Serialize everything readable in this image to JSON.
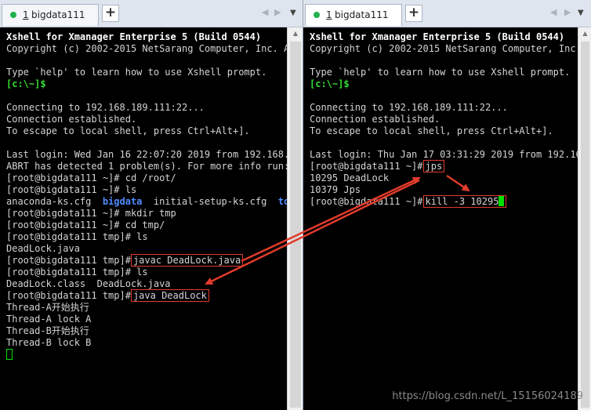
{
  "left_pane": {
    "tab": {
      "number": "1",
      "name": "bigdata111"
    },
    "add_tab": "+",
    "nav": {
      "prev": "◀",
      "next": "▶",
      "menu": "▼"
    },
    "lines": [
      [
        {
          "t": "Xshell for Xmanager Enterprise 5 (Build 0544)",
          "s": "b"
        }
      ],
      [
        {
          "t": "Copyright (c) 2002-2015 NetSarang Computer, Inc. A"
        }
      ],
      [],
      [
        {
          "t": "Type `help' to learn how to use Xshell prompt."
        }
      ],
      [
        {
          "t": "[c:\\~]$",
          "s": "green"
        }
      ],
      [],
      [
        {
          "t": "Connecting to 192.168.189.111:22..."
        }
      ],
      [
        {
          "t": "Connection established."
        }
      ],
      [
        {
          "t": "To escape to local shell, press Ctrl+Alt+]."
        }
      ],
      [],
      [
        {
          "t": "Last login: Wed Jan 16 22:07:20 2019 from 192.168."
        }
      ],
      [
        {
          "t": "ABRT has detected 1 problem(s). For more info run:"
        }
      ],
      [
        {
          "t": "[root@bigdata111 ~]# cd /root/"
        }
      ],
      [
        {
          "t": "[root@bigdata111 ~]# ls"
        }
      ],
      [
        {
          "t": "anaconda-ks.cfg  "
        },
        {
          "t": "bigdata",
          "s": "blue"
        },
        {
          "t": "  initial-setup-ks.cfg  "
        },
        {
          "t": "to",
          "s": "blue"
        }
      ],
      [
        {
          "t": "[root@bigdata111 ~]# mkdir tmp"
        }
      ],
      [
        {
          "t": "[root@bigdata111 ~]# cd tmp/"
        }
      ],
      [
        {
          "t": "[root@bigdata111 tmp]# ls"
        }
      ],
      [
        {
          "t": "DeadLock.java"
        }
      ],
      [
        {
          "t": "[root@bigdata111 tmp]#"
        },
        {
          "t": "javac DeadLock.java",
          "s": "hl"
        }
      ],
      [
        {
          "t": "[root@bigdata111 tmp]# ls"
        }
      ],
      [
        {
          "t": "DeadLock.class  DeadLock.java"
        }
      ],
      [
        {
          "t": "[root@bigdata111 tmp]#"
        },
        {
          "t": "java DeadLock",
          "s": "hl"
        }
      ],
      [
        {
          "t": "Thread-A开始执行"
        }
      ],
      [
        {
          "t": "Thread-A lock A"
        }
      ],
      [
        {
          "t": "Thread-B开始执行"
        }
      ],
      [
        {
          "t": "Thread-B lock B"
        }
      ],
      [
        {
          "t": "",
          "s": "cursor-hollow"
        }
      ]
    ]
  },
  "right_pane": {
    "tab": {
      "number": "1",
      "name": "bigdata111"
    },
    "add_tab": "+",
    "nav": {
      "prev": "◀",
      "next": "▶",
      "menu": "▼"
    },
    "lines": [
      [
        {
          "t": "Xshell for Xmanager Enterprise 5 (Build 0544)",
          "s": "b"
        }
      ],
      [
        {
          "t": "Copyright (c) 2002-2015 NetSarang Computer, Inc. A"
        }
      ],
      [],
      [
        {
          "t": "Type `help' to learn how to use Xshell prompt."
        }
      ],
      [
        {
          "t": "[c:\\~]$",
          "s": "green"
        }
      ],
      [],
      [
        {
          "t": "Connecting to 192.168.189.111:22..."
        }
      ],
      [
        {
          "t": "Connection established."
        }
      ],
      [
        {
          "t": "To escape to local shell, press Ctrl+Alt+]."
        }
      ],
      [],
      [
        {
          "t": "Last login: Thu Jan 17 03:31:29 2019 from 192.168."
        }
      ],
      [
        {
          "t": "[root@bigdata111 ~]#"
        },
        {
          "t": "jps",
          "s": "hl"
        }
      ],
      [
        {
          "t": "10295 DeadLock"
        }
      ],
      [
        {
          "t": "10379 Jps"
        }
      ],
      [
        {
          "t": "[root@bigdata111 ~]#"
        },
        {
          "t": "kill -3 10295",
          "s": "hl",
          "cursor": true
        }
      ]
    ]
  },
  "watermark": "https://blog.csdn.net/L_15156024189"
}
